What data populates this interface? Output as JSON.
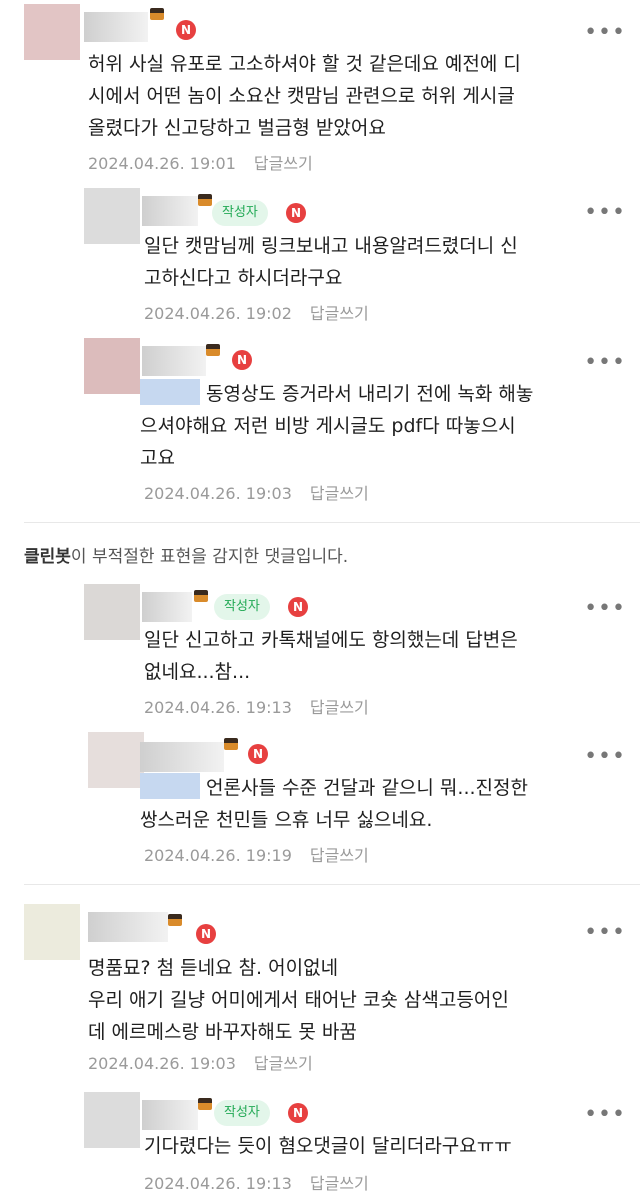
{
  "comments": [
    {
      "id": "c1",
      "level": 0,
      "is_author": false,
      "mention": false,
      "text_lines": [
        "허위 사실 유포로 고소하셔야 할 것 같은데요 예전에 디",
        "시에서 어떤 놈이 소요산 캣맘님 관련으로 허위 게시글",
        "올렸다가 신고당하고 벌금형 받았어요"
      ],
      "date": "2024.04.26. 19:01",
      "reply": "답글쓰기"
    },
    {
      "id": "c2",
      "level": 1,
      "is_author": true,
      "mention": false,
      "text_lines": [
        "일단 캣맘님께 링크보내고 내용알려드렸더니 신",
        "고하신다고 하시더라구요"
      ],
      "date": "2024.04.26. 19:02",
      "reply": "답글쓰기"
    },
    {
      "id": "c3",
      "level": 1,
      "is_author": false,
      "mention": true,
      "text_lines": [
        "동영상도 증거라서 내리기 전에 녹화 해놓",
        "으셔야해요 저런 비방 게시글도 pdf다 따놓으시",
        "고요"
      ],
      "date": "2024.04.26. 19:03",
      "reply": "답글쓰기"
    },
    {
      "id": "c4",
      "level": 1,
      "is_author": true,
      "mention": false,
      "text_lines": [
        "일단 신고하고 카톡채널에도 항의했는데 답변은",
        "없네요...참..."
      ],
      "date": "2024.04.26. 19:13",
      "reply": "답글쓰기"
    },
    {
      "id": "c5",
      "level": 1,
      "is_author": false,
      "mention": true,
      "text_lines": [
        "언론사들 수준 건달과 같으니 뭐...진정한",
        "쌍스러운 천민들 으휴 너무 싫으네요."
      ],
      "date": "2024.04.26. 19:19",
      "reply": "답글쓰기"
    },
    {
      "id": "c6",
      "level": 0,
      "is_author": false,
      "mention": false,
      "text_lines": [
        "명품묘? 첨 듣네요 참. 어이없네",
        "우리 애기 길냥 어미에게서 태어난 코숏 삼색고등어인",
        "데 에르메스랑 바꾸자해도 못 바꿈"
      ],
      "date": "2024.04.26. 19:03",
      "reply": "답글쓰기"
    },
    {
      "id": "c7",
      "level": 1,
      "is_author": true,
      "mention": false,
      "text_lines": [
        "기다렸다는 듯이 혐오댓글이 달리더라구요ㅠㅠ"
      ],
      "date": "2024.04.26. 19:13",
      "reply": "답글쓰기"
    }
  ],
  "labels": {
    "author": "작성자",
    "new_badge": "N",
    "more": "•••"
  },
  "notice": {
    "bot_name": "클린봇",
    "text": "이 부적절한 표현을 감지한 댓글입니다."
  },
  "colors": {
    "new_badge": "#e74040",
    "author_badge_bg": "#e3f6ea",
    "author_badge_text": "#22a955",
    "mention_highlight": "#c6d8f0"
  },
  "icons": {
    "new": "n-badge",
    "level": "cake-level-icon",
    "more": "more-dots-icon"
  }
}
